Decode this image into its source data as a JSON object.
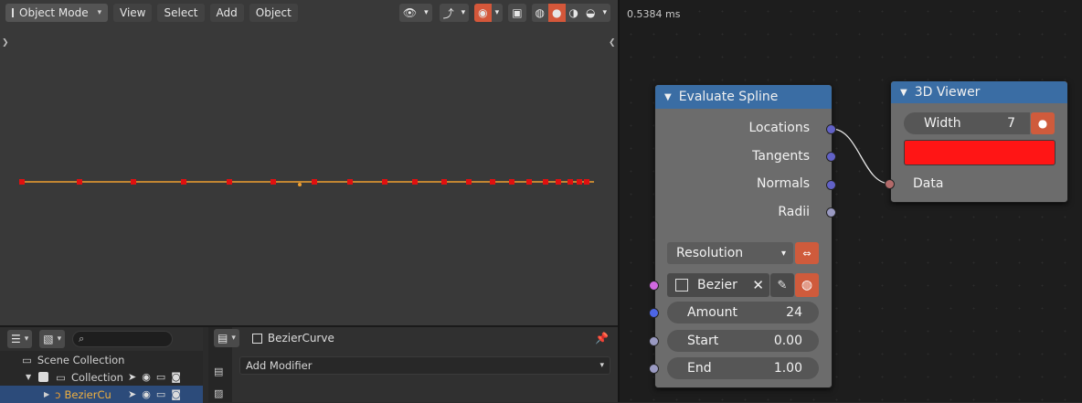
{
  "viewport": {
    "mode_label": "Object Mode",
    "menus": [
      "View",
      "Select",
      "Add",
      "Object"
    ]
  },
  "outliner": {
    "scene_collection": "Scene Collection",
    "collection": "Collection",
    "object": "BezierCurve"
  },
  "properties": {
    "object_name": "BezierCurve",
    "add_modifier": "Add Modifier"
  },
  "node_editor": {
    "timing": "0.5384 ms",
    "evaluate_spline": {
      "title": "Evaluate Spline",
      "outputs": [
        "Locations",
        "Tangents",
        "Normals",
        "Radii"
      ],
      "mode_dropdown": "Resolution",
      "object_value": "Bezier",
      "amount_label": "Amount",
      "amount_value": "24",
      "start_label": "Start",
      "start_value": "0.00",
      "end_label": "End",
      "end_value": "1.00"
    },
    "viewer": {
      "title": "3D Viewer",
      "width_label": "Width",
      "width_value": "7",
      "color": "#ff1515",
      "data_label": "Data"
    }
  },
  "colors": {
    "node_header": "#3a6da4",
    "active_button": "#d4573a",
    "selection": "#2c4b7a",
    "curve_points": "#e01010",
    "curve_line": "#f0a030"
  }
}
